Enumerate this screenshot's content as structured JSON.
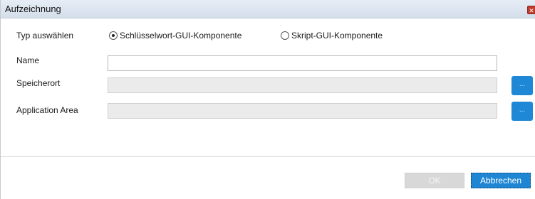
{
  "window": {
    "title": "Aufzeichnung"
  },
  "type_row": {
    "label": "Typ auswählen",
    "options": [
      {
        "label": "Schlüsselwort-GUI-Komponente",
        "selected": true
      },
      {
        "label": "Skript-GUI-Komponente",
        "selected": false
      }
    ]
  },
  "name": {
    "label": "Name",
    "value": ""
  },
  "storage": {
    "label": "Speicherort",
    "value": "",
    "browse_label": "..."
  },
  "app_area": {
    "label": "Application Area",
    "value": "",
    "browse_label": "..."
  },
  "buttons": {
    "ok_label": "OK",
    "cancel_label": "Abbrechen"
  },
  "colors": {
    "accent": "#1e88d6",
    "disabled_bg": "#ebebeb",
    "titlebar": "#dbe5f1"
  }
}
